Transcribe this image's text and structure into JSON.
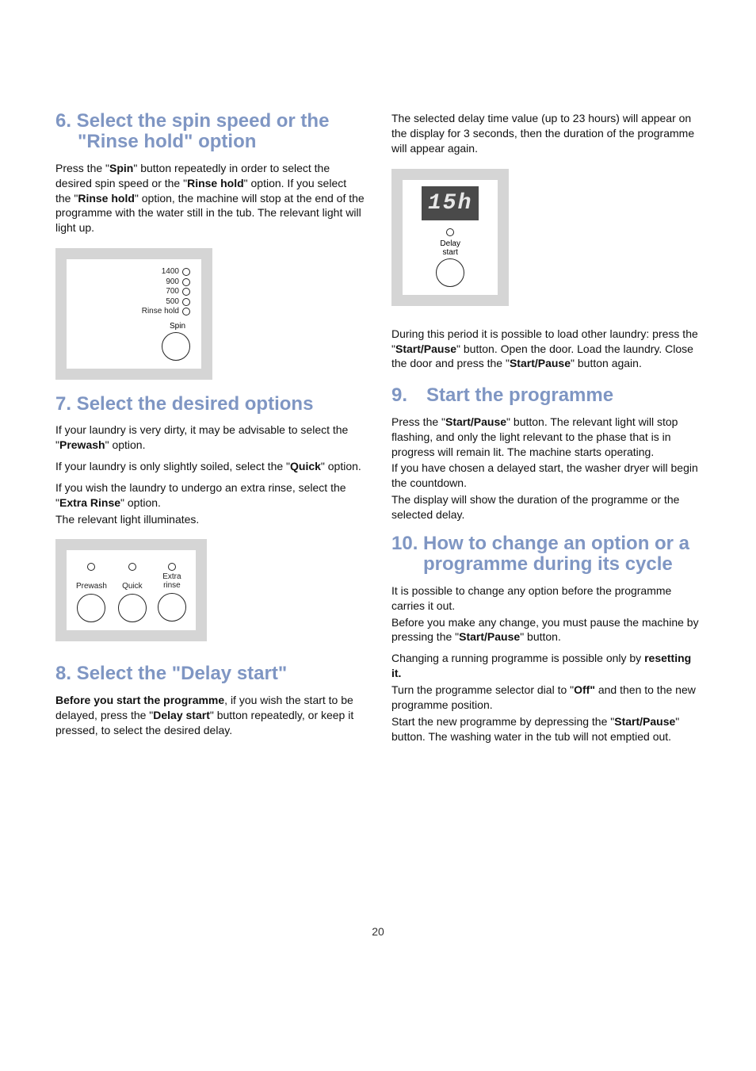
{
  "left": {
    "sec6": {
      "title": "6. Select the spin speed or the \"Rinse hold\" option",
      "p1_a": "Press the \"",
      "p1_b": "Spin",
      "p1_c": "\" button repeatedly in order to select the desired spin speed or the \"",
      "p1_d": "Rinse hold",
      "p1_e": "\" option. If you select the \"",
      "p1_f": "Rinse hold",
      "p1_g": "\" option, the machine will stop at the end of the programme with the water still in the tub. The relevant light will light up."
    },
    "fig_spin": {
      "v1400": "1400",
      "v900": "900",
      "v700": "700",
      "v500": "500",
      "rinse_hold": "Rinse hold",
      "spin": "Spin"
    },
    "sec7": {
      "title": "7. Select the desired options",
      "p1_a": "If your laundry is very dirty, it may be advisable to select the \"",
      "p1_b": "Prewash",
      "p1_c": "\" option.",
      "p2_a": "If your laundry is only slightly soiled, select the \"",
      "p2_b": "Quick",
      "p2_c": "\" option.",
      "p3_a": "If you wish the laundry to undergo an extra rinse, select the \"",
      "p3_b": "Extra Rinse",
      "p3_c": "\" option.",
      "p4": "The relevant light illuminates."
    },
    "fig_opts": {
      "prewash": "Prewash",
      "quick": "Quick",
      "extra_rinse_a": "Extra",
      "extra_rinse_b": "rinse"
    },
    "sec8": {
      "title": "8. Select the \"Delay start\"",
      "p1_a": "Before you start the programme",
      "p1_b": ", if you wish the start to be delayed, press the \"",
      "p1_c": "Delay start",
      "p1_d": "\" button repeatedly, or keep it pressed, to select the desired delay."
    }
  },
  "right": {
    "intro": "The selected delay time value (up to 23 hours) will appear on the display for 3 seconds, then the duration of the programme will appear again.",
    "fig_delay": {
      "display": "15h",
      "label_a": "Delay",
      "label_b": "start"
    },
    "after_fig_a": "During this period it is possible to load other laundry: press the \"",
    "after_fig_b": "Start/Pause",
    "after_fig_c": "\" button. Open the door. Load the laundry. Close the door and press the \"",
    "after_fig_d": "Start/Pause",
    "after_fig_e": "\" button again.",
    "sec9": {
      "title": "9. Start the programme",
      "p1_a": "Press the \"",
      "p1_b": "Start/Pause",
      "p1_c": "\" button. The relevant light will stop flashing, and only the light relevant to the phase that is in progress will remain lit. The machine starts operating.",
      "p2": "If you have chosen a delayed start, the washer dryer will begin the countdown.",
      "p3": "The display will show the duration of the programme or the selected delay."
    },
    "sec10": {
      "title": "10. How to change an option or a programme during its cycle",
      "p1": "It is possible to change any option before the programme carries it out.",
      "p2_a": "Before you make any change, you must pause the machine by pressing the \"",
      "p2_b": "Start/Pause",
      "p2_c": "\" button.",
      "p3_a": "Changing a running programme is possible only by ",
      "p3_b": "resetting it.",
      "p4_a": "Turn the programme selector dial to \"",
      "p4_b": "Off\"",
      "p4_c": " and then to the new programme position.",
      "p5_a": "Start the new programme by depressing the \"",
      "p5_b": "Start/Pause",
      "p5_c": "\" button. The washing water in the tub will not emptied out."
    }
  },
  "page_number": "20"
}
